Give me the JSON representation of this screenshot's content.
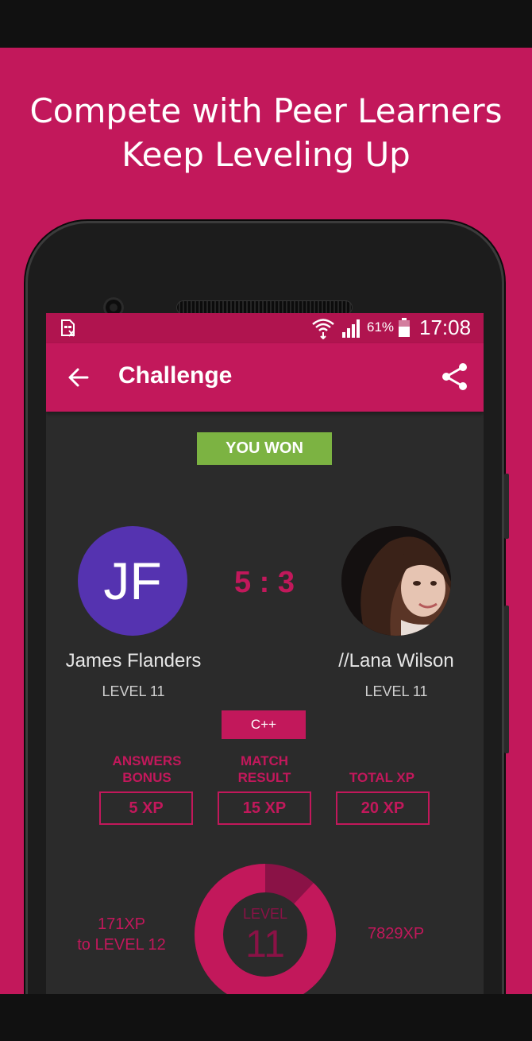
{
  "promo": {
    "headline_line1": "Compete with Peer Learners",
    "headline_line2": "Keep Leveling Up"
  },
  "status_bar": {
    "battery_percent": "61%",
    "time": "17:08",
    "icons": [
      "no-sim-icon",
      "wifi-icon",
      "signal-icon",
      "battery-icon"
    ]
  },
  "app_bar": {
    "title": "Challenge",
    "back_icon": "arrow-back-icon",
    "share_icon": "share-icon"
  },
  "result": {
    "badge": "YOU WON",
    "score": "5 : 3"
  },
  "players": [
    {
      "initials": "JF",
      "name": "James Flanders",
      "level": "LEVEL 11",
      "avatar_color": "#5533b0"
    },
    {
      "name": "//Lana Wilson",
      "level": "LEVEL 11"
    }
  ],
  "challenge": {
    "language": "C++",
    "stats": [
      {
        "label_line1": "ANSWERS",
        "label_line2": "BONUS",
        "value": "5 XP"
      },
      {
        "label_line1": "MATCH",
        "label_line2": "RESULT",
        "value": "15 XP"
      },
      {
        "label_line1": "",
        "label_line2": "TOTAL XP",
        "value": "20 XP"
      }
    ]
  },
  "progress": {
    "xp_to_next_line1": "171XP",
    "xp_to_next_line2": "to LEVEL 12",
    "level_label": "LEVEL",
    "level_value": "11",
    "total_xp": "7829XP",
    "level_progress_fraction": 0.88
  },
  "colors": {
    "accent": "#c2185b",
    "status_bar": "#b0144f",
    "won_badge": "#7cb342",
    "screen_bg": "#2b2b2b",
    "progress_remaining": "#8a1246"
  }
}
